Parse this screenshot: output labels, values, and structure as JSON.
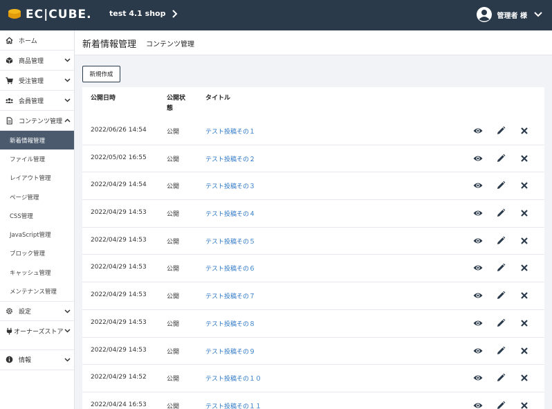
{
  "header": {
    "logo_text": "EC|CUBE.",
    "shop_name": "test 4.1 shop",
    "user_name": "管理者 様"
  },
  "sidebar": {
    "items": [
      {
        "label": "ホーム",
        "icon": "home-icon"
      },
      {
        "label": "商品管理",
        "icon": "product-box-icon"
      },
      {
        "label": "受注管理",
        "icon": "cart-icon"
      },
      {
        "label": "会員管理",
        "icon": "users-icon"
      },
      {
        "label": "コンテンツ管理",
        "icon": "file-icon"
      }
    ],
    "content_submenu": [
      "新着情報管理",
      "ファイル管理",
      "レイアウト管理",
      "ページ管理",
      "CSS管理",
      "JavaScript管理",
      "ブロック管理",
      "キャッシュ管理",
      "メンテナンス管理"
    ],
    "bottom_items": [
      {
        "label": "設定",
        "icon": "gear-icon"
      },
      {
        "label": "オーナーズストア",
        "icon": "plug-icon"
      },
      {
        "label": "情報",
        "icon": "info-icon"
      }
    ]
  },
  "page": {
    "title": "新着情報管理",
    "subtitle": "コンテンツ管理",
    "new_button": "新規作成"
  },
  "table": {
    "headers": {
      "date": "公開日時",
      "status": "公開状態",
      "title": "タイトル"
    },
    "rows": [
      {
        "date": "2022/06/26 14:54",
        "status": "公開",
        "title": "テスト投稿その１"
      },
      {
        "date": "2022/05/02 16:55",
        "status": "公開",
        "title": "テスト投稿その２"
      },
      {
        "date": "2022/04/29 14:54",
        "status": "公開",
        "title": "テスト投稿その３"
      },
      {
        "date": "2022/04/29 14:53",
        "status": "公開",
        "title": "テスト投稿その４"
      },
      {
        "date": "2022/04/29 14:53",
        "status": "公開",
        "title": "テスト投稿その５"
      },
      {
        "date": "2022/04/29 14:53",
        "status": "公開",
        "title": "テスト投稿その６"
      },
      {
        "date": "2022/04/29 14:53",
        "status": "公開",
        "title": "テスト投稿その７"
      },
      {
        "date": "2022/04/29 14:53",
        "status": "公開",
        "title": "テスト投稿その８"
      },
      {
        "date": "2022/04/29 14:53",
        "status": "公開",
        "title": "テスト投稿その９"
      },
      {
        "date": "2022/04/29 14:52",
        "status": "公開",
        "title": "テスト投稿その１０"
      },
      {
        "date": "2022/04/24 16:53",
        "status": "公開",
        "title": "テスト投稿その１１"
      }
    ]
  },
  "colors": {
    "header_bg": "#2a3a4b",
    "active_bg": "#4b5b6d",
    "link": "#2a76c6",
    "page_bg": "#f1f3f6"
  }
}
